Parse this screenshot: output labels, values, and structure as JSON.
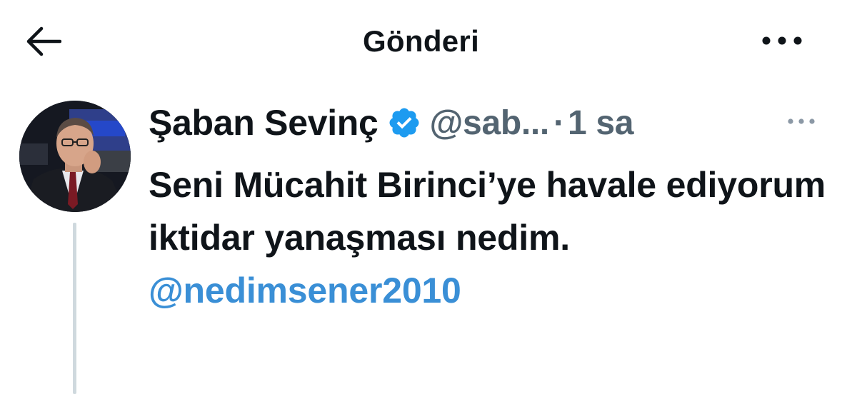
{
  "header": {
    "title": "Gönderi",
    "back_icon": "arrow-left-icon",
    "more_icon": "more-horizontal-icon"
  },
  "post": {
    "display_name": "Şaban Sevinç",
    "verified_icon": "verified-badge-icon",
    "handle": "@sab...",
    "separator": "·",
    "time": "1 sa",
    "text_before_mention": "Seni Mücahit Birinci’ye havale ediyorum iktidar yanaşması nedim. ",
    "mention": "@nedimsener2010",
    "more_icon": "more-horizontal-icon"
  },
  "colors": {
    "text": "#0f1419",
    "secondary": "#536471",
    "link": "#3a8fd6",
    "verified": "#1d9bf0",
    "thread_line": "#cfd9de"
  }
}
